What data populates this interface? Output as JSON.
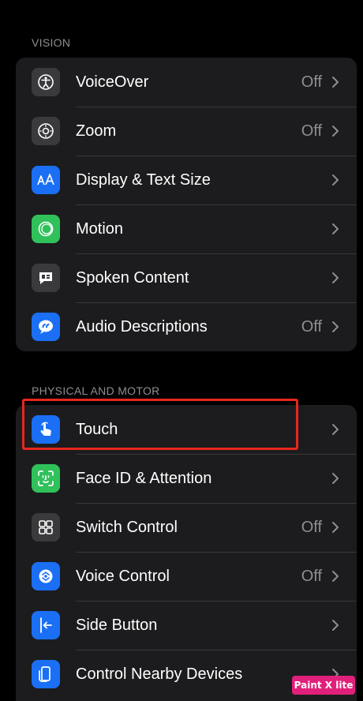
{
  "sections": [
    {
      "header": "VISION",
      "items": [
        {
          "label": "VoiceOver",
          "value": "Off",
          "icon": "voiceover-icon",
          "color": "#3a3a3c"
        },
        {
          "label": "Zoom",
          "value": "Off",
          "icon": "zoom-icon",
          "color": "#3a3a3c"
        },
        {
          "label": "Display & Text Size",
          "value": "",
          "icon": "text-size-icon",
          "color": "#1a6ff5"
        },
        {
          "label": "Motion",
          "value": "",
          "icon": "motion-icon",
          "color": "#30c15b"
        },
        {
          "label": "Spoken Content",
          "value": "",
          "icon": "spoken-content-icon",
          "color": "#3a3a3c"
        },
        {
          "label": "Audio Descriptions",
          "value": "Off",
          "icon": "audio-descriptions-icon",
          "color": "#1a6ff5"
        }
      ]
    },
    {
      "header": "PHYSICAL AND MOTOR",
      "items": [
        {
          "label": "Touch",
          "value": "",
          "icon": "touch-hand-icon",
          "color": "#1a6ff5"
        },
        {
          "label": "Face ID & Attention",
          "value": "",
          "icon": "face-id-icon",
          "color": "#30c15b"
        },
        {
          "label": "Switch Control",
          "value": "Off",
          "icon": "switch-control-icon",
          "color": "#3a3a3c"
        },
        {
          "label": "Voice Control",
          "value": "Off",
          "icon": "voice-control-icon",
          "color": "#1a6ff5"
        },
        {
          "label": "Side Button",
          "value": "",
          "icon": "side-button-icon",
          "color": "#1a6ff5"
        },
        {
          "label": "Control Nearby Devices",
          "value": "",
          "icon": "nearby-devices-icon",
          "color": "#1a6ff5"
        }
      ]
    }
  ],
  "watermark": "Paint X lite",
  "highlight_color": "#e8261d"
}
